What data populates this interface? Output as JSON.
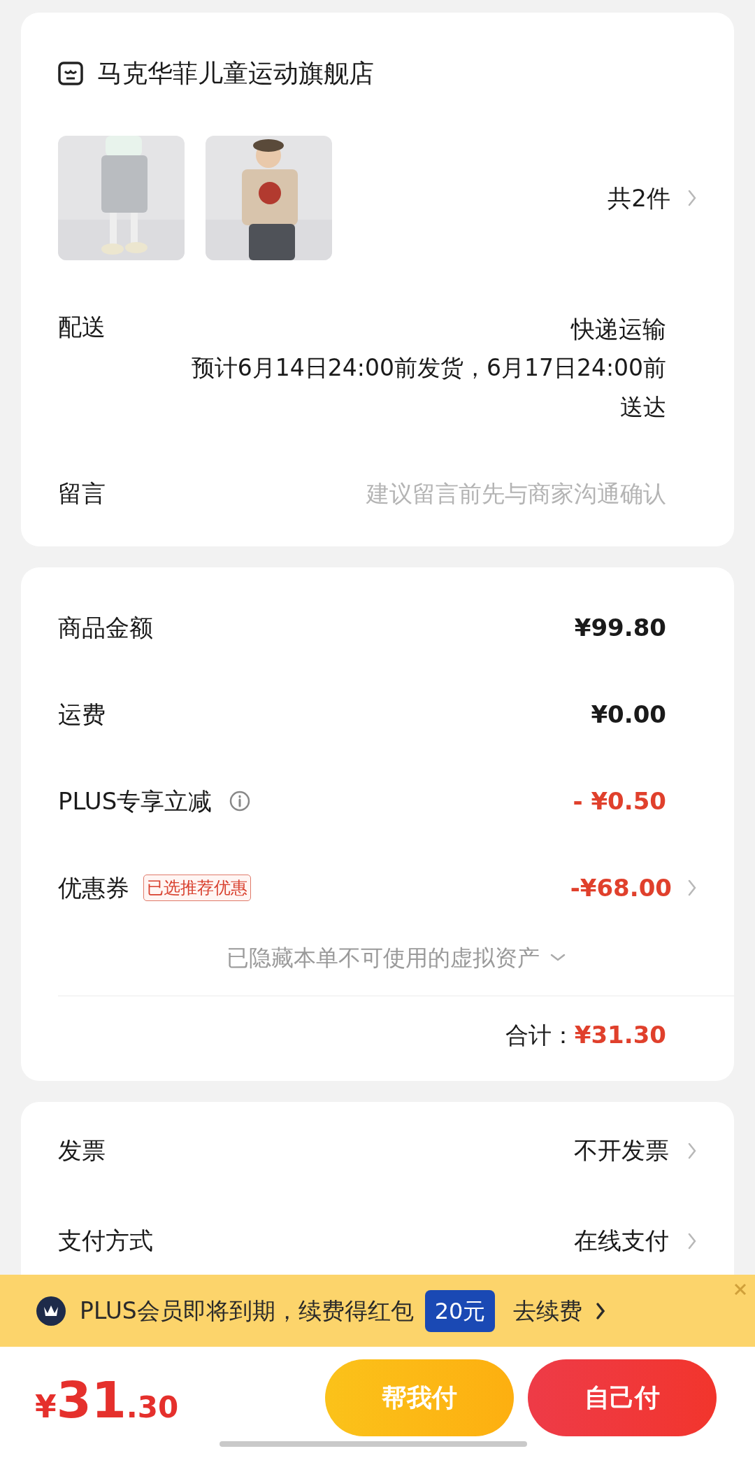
{
  "store": {
    "name": "马克华菲儿童运动旗舰店"
  },
  "products": {
    "count": "共2件"
  },
  "delivery": {
    "label": "配送",
    "method": "快递运输",
    "estimate": "预计6月14日24:00前发货，6月17日24:00前送达"
  },
  "message": {
    "label": "留言",
    "placeholder": "建议留言前先与商家沟通确认"
  },
  "amounts": [
    {
      "label": "商品金额",
      "value": "¥99.80",
      "discount": false,
      "arrow": false
    },
    {
      "label": "运费",
      "value": "¥0.00",
      "discount": false,
      "arrow": false
    },
    {
      "label": "PLUS专享立减",
      "value": "- ¥0.50",
      "discount": true,
      "arrow": false,
      "info": true
    },
    {
      "label": "优惠券",
      "value": "-¥68.00",
      "discount": true,
      "arrow": true,
      "tag": "已选推荐优惠"
    }
  ],
  "hidden_assets": "已隐藏本单不可使用的虚拟资产",
  "total": {
    "label": "合计：",
    "value": "¥31.30"
  },
  "options": [
    {
      "label": "发票",
      "value": "不开发票"
    },
    {
      "label": "支付方式",
      "value": "在线支付"
    }
  ],
  "banner": {
    "text": "PLUS会员即将到期，续费得红包",
    "badge": "20元",
    "action": "去续费"
  },
  "footer": {
    "currency": "¥",
    "price_main": "31",
    "price_cents": ".30",
    "buttons": [
      {
        "label": "帮我付",
        "kind": "secondary"
      },
      {
        "label": "自己付",
        "kind": "primary"
      }
    ]
  }
}
